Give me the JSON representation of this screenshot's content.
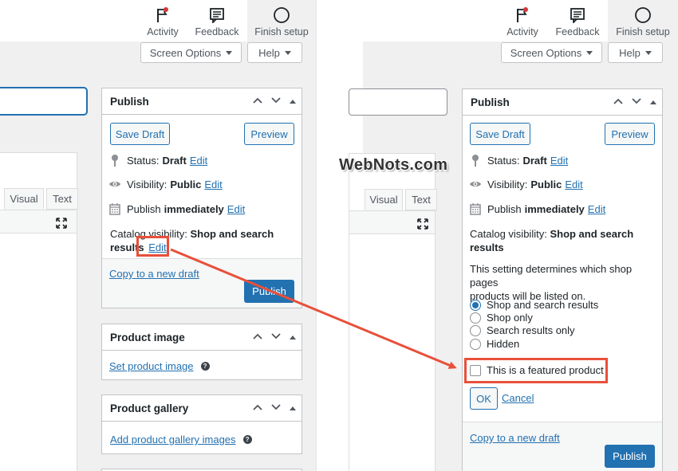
{
  "topbar": {
    "activity_label": "Activity",
    "feedback_label": "Feedback",
    "finish_setup_label": "Finish setup"
  },
  "screen_options": {
    "screen_options_label": "Screen Options",
    "help_label": "Help"
  },
  "editor": {
    "tab_visual": "Visual",
    "tab_text": "Text"
  },
  "publish_box": {
    "title": "Publish",
    "save_draft_label": "Save Draft",
    "preview_label": "Preview",
    "status_label": "Status:",
    "status_value": "Draft",
    "visibility_label": "Visibility:",
    "visibility_value": "Public",
    "publish_label": "Publish",
    "publish_value": "immediately",
    "edit_label": "Edit",
    "catalog_label": "Catalog visibility:",
    "catalog_value_line1": "Shop and search",
    "catalog_value_line2": "results",
    "catalog_value_left_l1": "Shop and search",
    "catalog_value_left_l2": "results",
    "copy_draft_label": "Copy to a new draft",
    "publish_button_label": "Publish"
  },
  "catalog_options": {
    "description_line1": "This setting determines which shop pages",
    "description_line2": "products will be listed on.",
    "options": [
      {
        "label": "Shop and search results",
        "selected": true
      },
      {
        "label": "Shop only",
        "selected": false
      },
      {
        "label": "Search results only",
        "selected": false
      },
      {
        "label": "Hidden",
        "selected": false
      }
    ],
    "featured_label": "This is a featured product",
    "featured_checked": false,
    "ok_label": "OK",
    "cancel_label": "Cancel"
  },
  "product_image_box": {
    "title": "Product image",
    "link_label": "Set product image"
  },
  "product_gallery_box": {
    "title": "Product gallery",
    "link_label": "Add product gallery images"
  },
  "watermark": "WebNots.com",
  "colors": {
    "accent": "#2271b1",
    "highlight": "#e8503a",
    "background": "#f0f0f1",
    "activity_dot": "#d63638"
  },
  "icons": [
    "flag-icon",
    "feedback-icon",
    "circle-icon",
    "pin-icon",
    "eye-icon",
    "calendar-icon",
    "chevron-up-icon",
    "chevron-down-icon",
    "triangle-up-icon",
    "fullscreen-icon",
    "help-icon"
  ]
}
